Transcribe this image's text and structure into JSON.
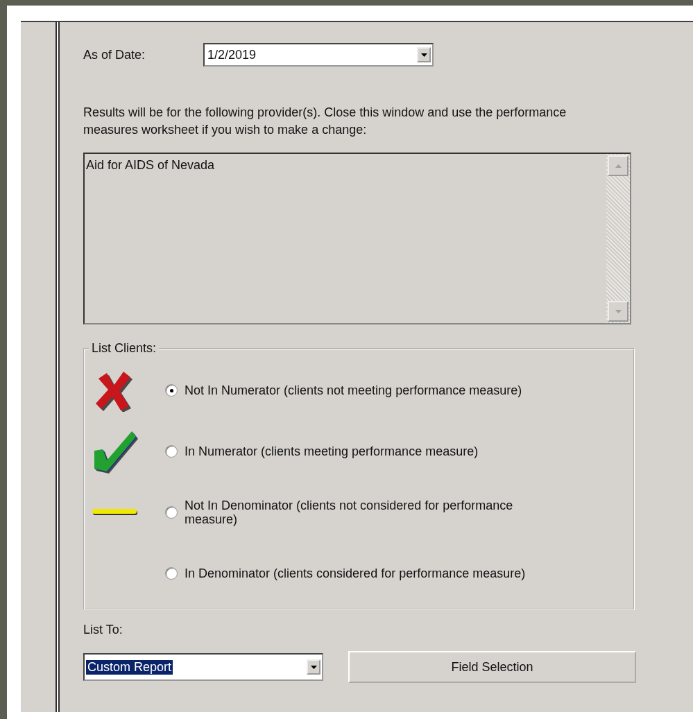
{
  "as_of_date": {
    "label": "As of Date:",
    "value": "1/2/2019"
  },
  "providers": {
    "note": "Results will be for the following provider(s). Close this window and use the performance measures worksheet if you wish to make a change:",
    "items": [
      "Aid for AIDS of Nevada"
    ]
  },
  "list_clients": {
    "legend": "List Clients:",
    "options": [
      {
        "kind": "cross",
        "label": "Not In Numerator (clients not meeting performance measure)",
        "selected": true
      },
      {
        "kind": "check",
        "label": "In Numerator (clients meeting performance measure)",
        "selected": false
      },
      {
        "kind": "dash",
        "label": "Not In Denominator (clients not considered for performance measure)",
        "selected": false
      },
      {
        "kind": "plain",
        "label": "In Denominator (clients considered for performance measure)",
        "selected": false
      }
    ]
  },
  "list_to": {
    "label": "List To:",
    "value": "Custom Report",
    "highlighted": true
  },
  "buttons": [
    "Field Selection"
  ]
}
